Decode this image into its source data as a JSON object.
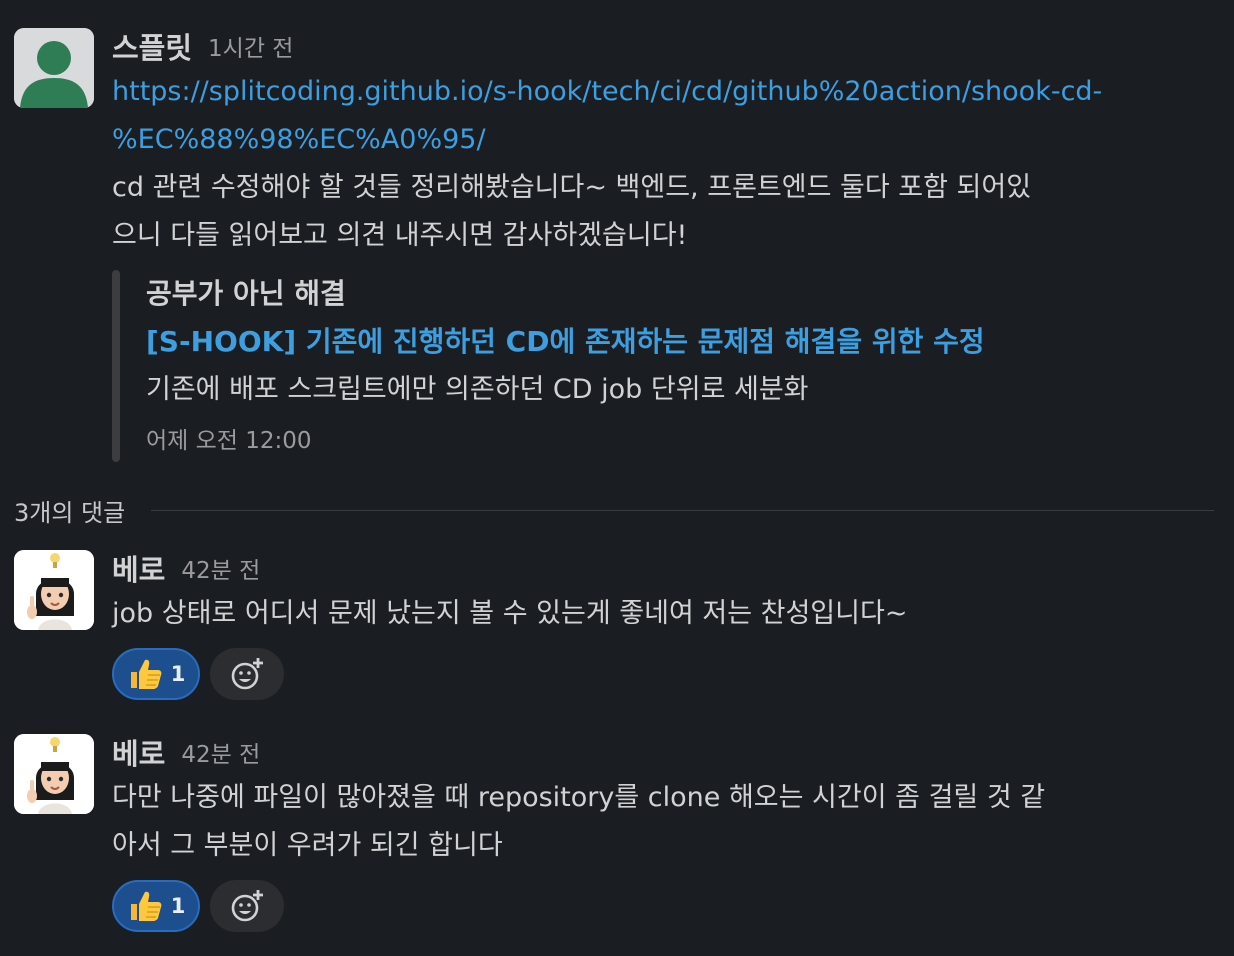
{
  "message": {
    "author": "스플릿",
    "time": "1시간 전",
    "link_line1": "https://splitcoding.github.io/s-hook/tech/ci/cd/github%20action/shook-cd-",
    "link_line2": "%EC%88%98%EC%A0%95/",
    "text_line1": "cd 관련 수정해야 할 것들 정리해봤습니다~ 백엔드, 프론트엔드 둘다 포함 되어있",
    "text_line2": "으니 다들 읽어보고 의견 내주시면 감사하겠습니다!",
    "attachment": {
      "author": "공부가 아닌 해결",
      "title": "[S-HOOK] 기존에 진행하던 CD에 존재하는 문제점 해결을 위한 수정",
      "text": "기존에 배포 스크립트에만 의존하던 CD job 단위로 세분화",
      "footer": "어제 오전 12:00"
    }
  },
  "thread": {
    "reply_count_label": "3개의 댓글"
  },
  "replies": [
    {
      "author": "베로",
      "time": "42분 전",
      "text_line1": "job 상태로 어디서 문제 났는지 볼 수 있는게 좋네여 저는 찬성입니다~",
      "text_line2": "",
      "reaction_count": "1"
    },
    {
      "author": "베로",
      "time": "42분 전",
      "text_line1": "다만 나중에 파일이 많아졌을 때 repository를 clone 해오는 시간이 좀 걸릴 것 같",
      "text_line2": "아서 그 부분이 우려가 되긴 합니다",
      "reaction_count": "1"
    }
  ],
  "icons": {
    "reaction_emoji": "thumbs-up-icon",
    "add_reaction": "add-reaction-icon",
    "default_avatar": "user-silhouette-icon",
    "memoji_avatar": "memoji-icon"
  },
  "colors": {
    "background": "#1a1d21",
    "link": "#3d9ee0",
    "reaction_active": "#1d4f8f",
    "default_avatar_figure": "#2e7d55"
  }
}
